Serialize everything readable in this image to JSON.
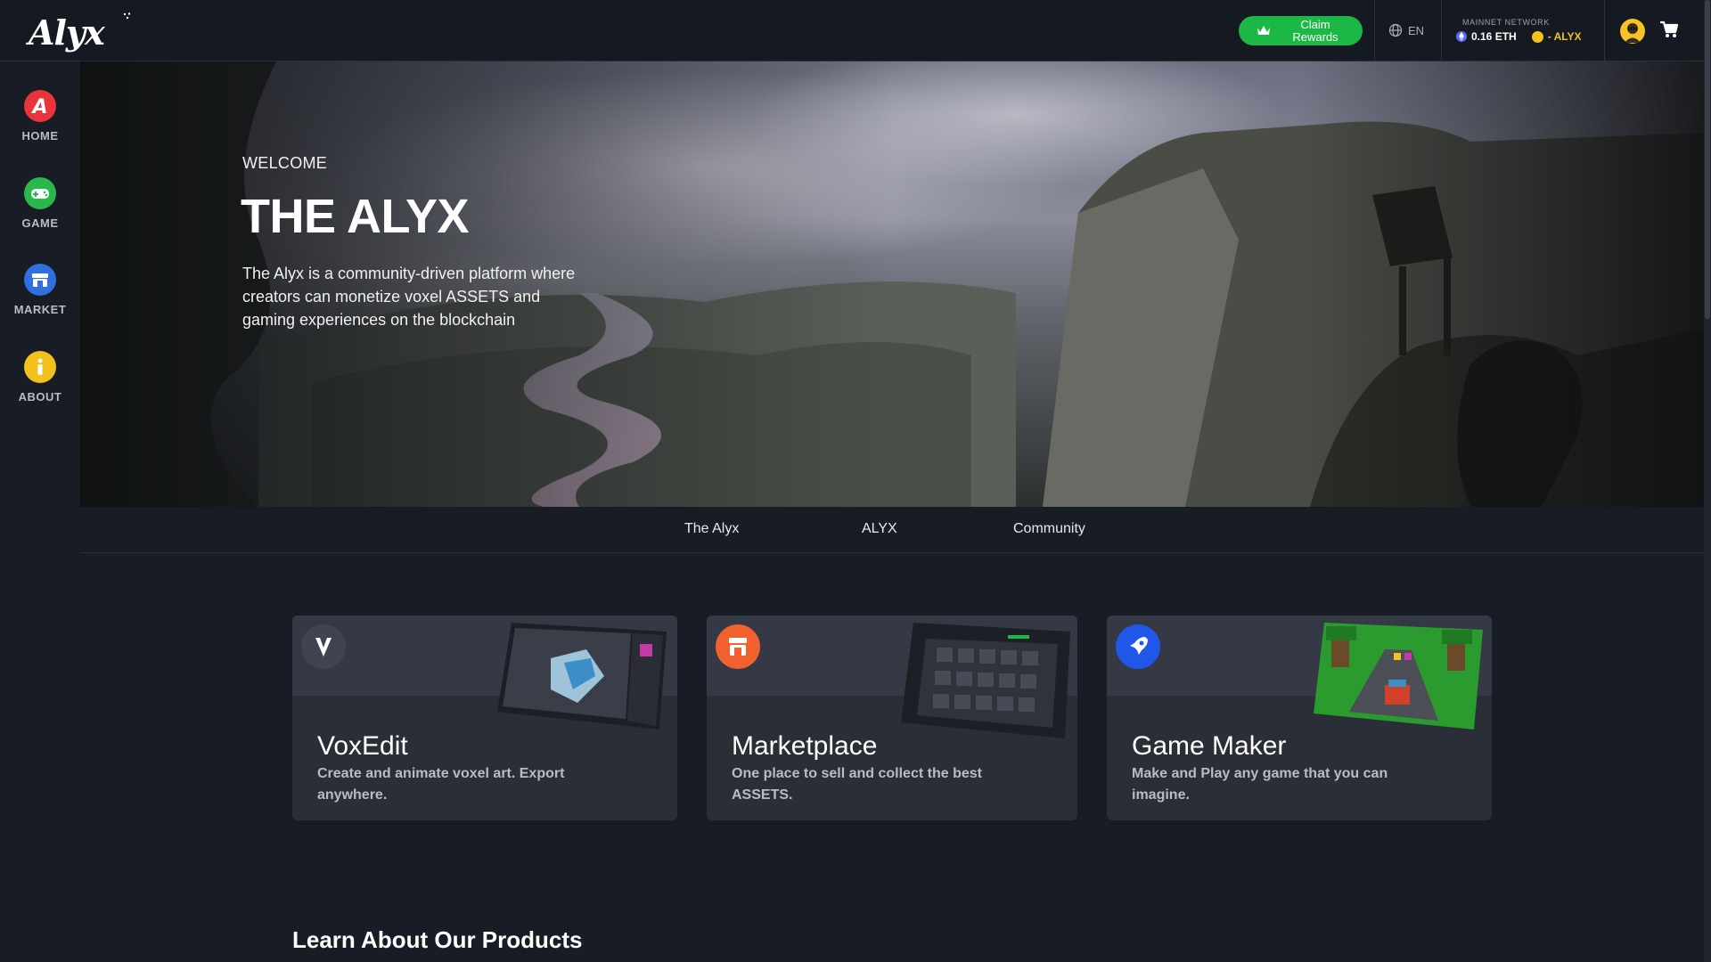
{
  "header": {
    "logo_text": "Alyx",
    "claim_button_label": "Claim Rewards",
    "language": "EN",
    "network_label": "MAINNET NETWORK",
    "eth_balance": "0.16 ETH",
    "alyx_balance": "- ALYX",
    "icons": [
      "globe-icon",
      "eth-icon",
      "alyx-coin-icon",
      "crown-icon",
      "avatar",
      "cart-icon"
    ]
  },
  "sidebar": {
    "items": [
      {
        "label": "HOME",
        "icon": "home-icon",
        "color": "#e8343a"
      },
      {
        "label": "GAME",
        "icon": "gamepad-icon",
        "color": "#2bb84a"
      },
      {
        "label": "MARKET",
        "icon": "market-icon",
        "color": "#2f6fe0"
      },
      {
        "label": "ABOUT",
        "icon": "info-icon",
        "color": "#f2c11c"
      }
    ]
  },
  "hero": {
    "welcome": "WELCOME",
    "title": "THE ALYX",
    "description": "The Alyx is a community-driven platform where creators can monetize voxel ASSETS and gaming experiences on the blockchain"
  },
  "tabs": [
    "The Alyx",
    "ALYX",
    "Community"
  ],
  "cards": [
    {
      "title": "VoxEdit",
      "description": "Create and animate voxel art. Export anywhere.",
      "icon": "voxedit-icon"
    },
    {
      "title": "Marketplace",
      "description": "One place to sell and collect the best ASSETS.",
      "icon": "marketplace-icon"
    },
    {
      "title": "Game Maker",
      "description": "Make and Play any game that you can imagine.",
      "icon": "gamemaker-icon"
    }
  ],
  "section_title": "Learn About Our Products",
  "colors": {
    "background": "#181c24",
    "claim_green": "#1cb845",
    "alyx_gold": "#f4c21a",
    "card_bg": "#292e37"
  }
}
